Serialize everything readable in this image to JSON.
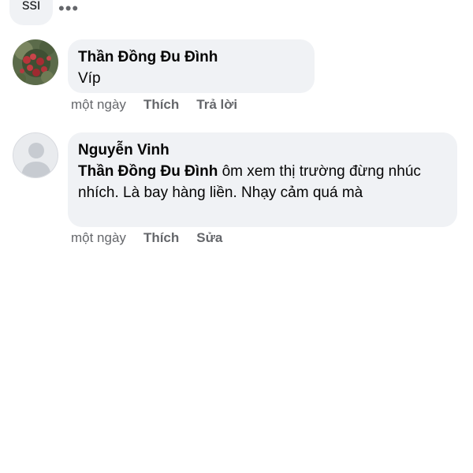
{
  "top": {
    "partial_text": "ssi",
    "more_icon": "more-horizontal-icon"
  },
  "comments": [
    {
      "author": "Thần Đồng Đu Đình",
      "text": "Víp",
      "time": "một ngày",
      "actions": [
        "Thích",
        "Trả lời"
      ],
      "avatar": "photo-avatar"
    },
    {
      "author": "Nguyễn Vinh",
      "mention": "Thần Đồng Đu Đình",
      "text": " ôm xem thị trường đừng nhúc nhích. Là bay hàng liền. Nhạy cảm quá mà",
      "time": "một ngày",
      "actions": [
        "Thích",
        "Sửa"
      ],
      "avatar": "default-profile-avatar"
    }
  ],
  "colors": {
    "bubble": "#f0f2f5",
    "secondary_text": "#65676b",
    "primary_text": "#050505"
  }
}
